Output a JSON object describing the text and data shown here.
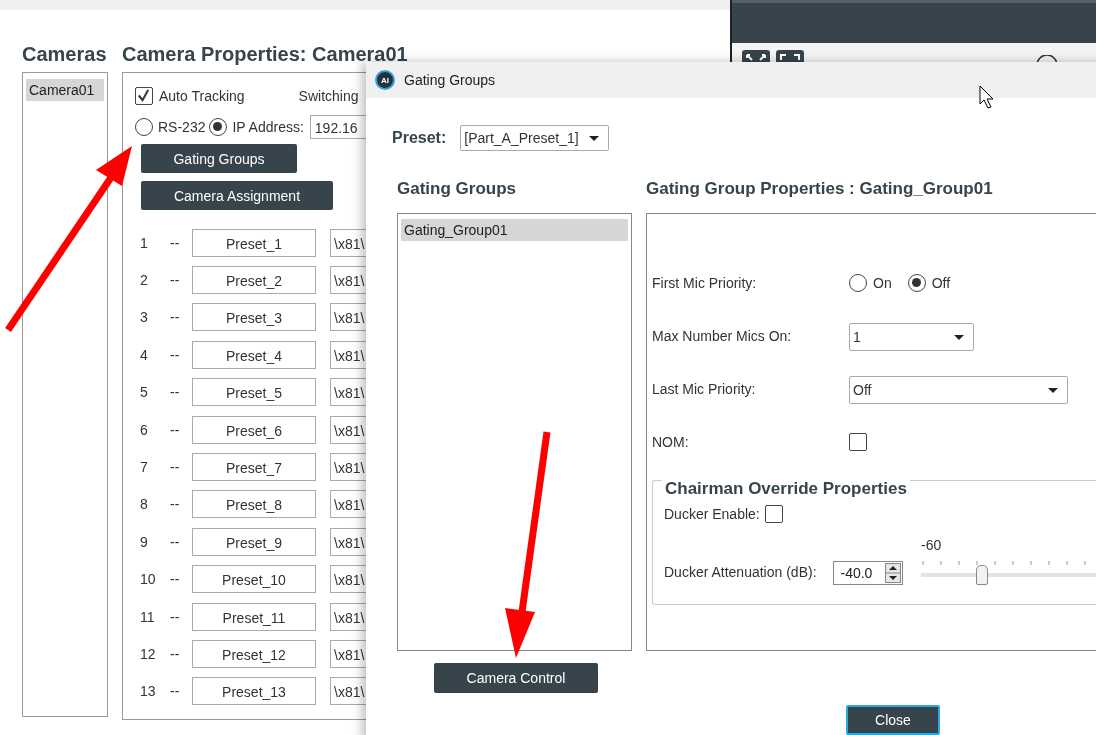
{
  "main_window": {
    "cameras_heading": "Cameras",
    "properties_heading": "Camera Properties: Camera01",
    "cameras": [
      {
        "label": "Camera01",
        "selected": true
      }
    ],
    "auto_tracking": {
      "label": "Auto Tracking",
      "checked": true
    },
    "switching_label": "Switching",
    "connection": [
      {
        "label": "RS-232",
        "selected": false
      },
      {
        "label": "IP Address:",
        "selected": true
      }
    ],
    "ip_address": "192.16",
    "buttons": [
      "Gating Groups",
      "Camera Assignment"
    ],
    "presets": [
      {
        "number": "1",
        "separator": "--",
        "name": "Preset_1",
        "command": "\\x81\\"
      },
      {
        "number": "2",
        "separator": "--",
        "name": "Preset_2",
        "command": "\\x81\\"
      },
      {
        "number": "3",
        "separator": "--",
        "name": "Preset_3",
        "command": "\\x81\\"
      },
      {
        "number": "4",
        "separator": "--",
        "name": "Preset_4",
        "command": "\\x81\\"
      },
      {
        "number": "5",
        "separator": "--",
        "name": "Preset_5",
        "command": "\\x81\\"
      },
      {
        "number": "6",
        "separator": "--",
        "name": "Preset_6",
        "command": "\\x81\\"
      },
      {
        "number": "7",
        "separator": "--",
        "name": "Preset_7",
        "command": "\\x81\\"
      },
      {
        "number": "8",
        "separator": "--",
        "name": "Preset_8",
        "command": "\\x81\\"
      },
      {
        "number": "9",
        "separator": "--",
        "name": "Preset_9",
        "command": "\\x81\\"
      },
      {
        "number": "10",
        "separator": "--",
        "name": "Preset_10",
        "command": "\\x81\\"
      },
      {
        "number": "11",
        "separator": "--",
        "name": "Preset_11",
        "command": "\\x81\\"
      },
      {
        "number": "12",
        "separator": "--",
        "name": "Preset_12",
        "command": "\\x81\\"
      },
      {
        "number": "13",
        "separator": "--",
        "name": "Preset_13",
        "command": "\\x81\\"
      }
    ]
  },
  "dialog": {
    "title": "Gating Groups",
    "logo": "AI",
    "preset_label": "Preset:",
    "preset": "[Part_A_Preset_1]",
    "groups_heading": "Gating Groups",
    "groups": [
      {
        "label": "Gating_Group01",
        "selected": true
      }
    ],
    "properties_heading": "Gating Group Properties : Gating_Group01",
    "first_mic_priority": {
      "label": "First Mic Priority:",
      "options": [
        {
          "label": "On",
          "selected": false
        },
        {
          "label": "Off",
          "selected": true
        }
      ]
    },
    "max_mics": {
      "label": "Max Number Mics On:",
      "value": "1"
    },
    "last_mic_priority": {
      "label": "Last Mic Priority:",
      "value": "Off"
    },
    "nom": {
      "label": "NOM:",
      "checked": false
    },
    "chairman": {
      "title": "Chairman Override Properties",
      "ducker_enable": {
        "label": "Ducker Enable:",
        "checked": false
      },
      "ducker_attenuation": {
        "label": "Ducker Attenuation (dB):",
        "value": "-40.0",
        "scale_min": "-60",
        "level": 0.333
      }
    },
    "camera_control_button": "Camera Control",
    "close_button": "Close"
  }
}
